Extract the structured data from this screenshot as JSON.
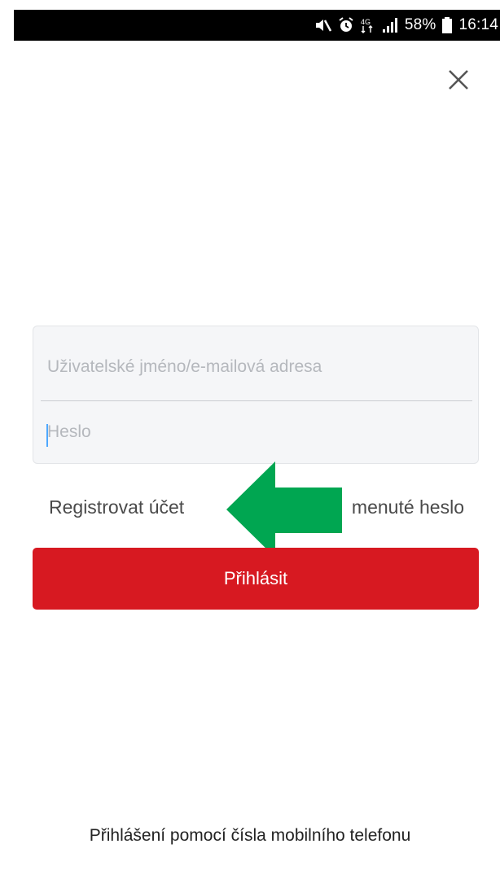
{
  "status_bar": {
    "icons": [
      "mute-icon",
      "alarm-icon",
      "network-4g-icon",
      "signal-icon",
      "battery-icon"
    ],
    "network": "4G",
    "battery_percent": "58%",
    "time": "16:14"
  },
  "close": {
    "icon": "close-icon"
  },
  "login_form": {
    "username_placeholder": "Uživatelské jméno/e-mailová adresa",
    "username_value": "",
    "password_placeholder": "Heslo",
    "password_value": ""
  },
  "links": {
    "register": "Registrovat účet",
    "forgot_password": "menuté heslo"
  },
  "login_button": {
    "label": "Přihlásit"
  },
  "phone_login": {
    "label": "Přihlášení pomocí čísla mobilního telefonu"
  },
  "colors": {
    "brand_red": "#d71921",
    "arrow_green": "#00a651",
    "card_bg": "#f5f6f8"
  }
}
